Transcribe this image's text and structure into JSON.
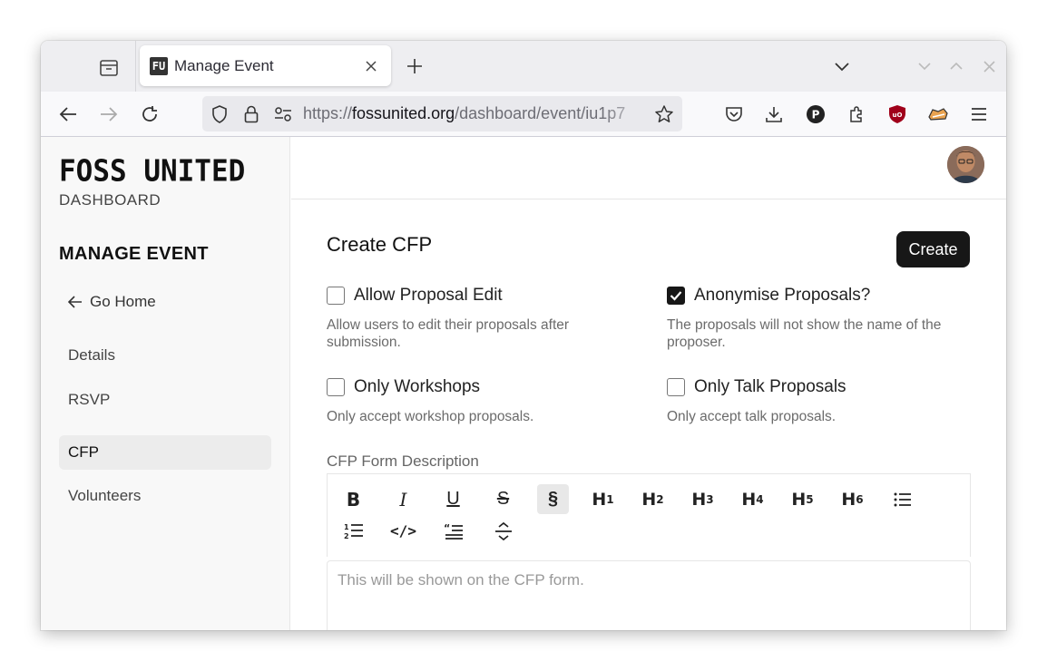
{
  "browser": {
    "tab_title": "Manage Event",
    "tab_favicon": "FU",
    "url_prefix": "https://",
    "url_domain": "fossunited.org",
    "url_path": "/dashboard/event/iu1p7"
  },
  "sidebar": {
    "logo": "FOSS UNITED",
    "logo_sub": "DASHBOARD",
    "section_title": "MANAGE EVENT",
    "go_home": "Go Home",
    "items": [
      {
        "label": "Details"
      },
      {
        "label": "RSVP"
      },
      {
        "label": "CFP",
        "active": true
      },
      {
        "label": "Volunteers"
      }
    ]
  },
  "main": {
    "title": "Create CFP",
    "create_label": "Create",
    "options": [
      {
        "label": "Allow Proposal Edit",
        "desc": "Allow users to edit their proposals after submission.",
        "checked": false
      },
      {
        "label": "Anonymise Proposals?",
        "desc": "The proposals will not show the name of the proposer.",
        "checked": true
      },
      {
        "label": "Only Workshops",
        "desc": "Only accept workshop proposals.",
        "checked": false
      },
      {
        "label": "Only Talk Proposals",
        "desc": "Only accept talk proposals.",
        "checked": false
      }
    ],
    "form_label": "CFP Form Description",
    "editor_placeholder": "This will be shown on the CFP form.",
    "toolbar": {
      "bold": "B",
      "italic": "I",
      "underline": "U",
      "strike": "S",
      "section": "§",
      "h1": "H",
      "h1n": "1",
      "h2": "H",
      "h2n": "2",
      "h3": "H",
      "h3n": "3",
      "h4": "H",
      "h4n": "4",
      "h5": "H",
      "h5n": "5",
      "h6": "H",
      "h6n": "6",
      "code": "</>"
    }
  },
  "colors": {
    "accent": "#171717",
    "sidebar_bg": "#f8f8f8"
  }
}
